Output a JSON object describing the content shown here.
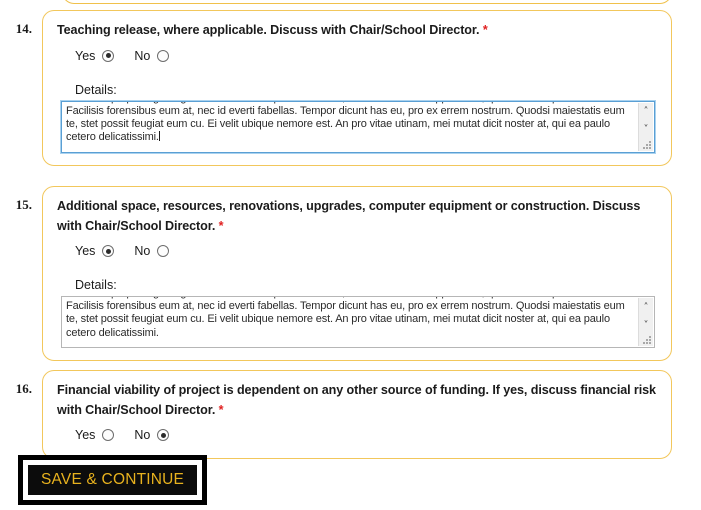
{
  "form": {
    "questions": [
      {
        "number": "14.",
        "text": "Teaching release, where applicable. Discuss with Chair/School Director.",
        "required_marker": "*",
        "radio_group": {
          "options": [
            {
              "label": "Yes",
              "selected": true
            },
            {
              "label": "No",
              "selected": false
            }
          ]
        },
        "details": {
          "label": "Details:",
          "value": "ius nobis propriae gubergren cu. Graeco vulputate ne nam, ius ex elaboraret appellantur, quo cibo erat prima an. Facilisis forensibus eum at, nec id everti fabellas. Tempor dicunt has eu, pro ex errem nostrum. Quodsi maiestatis eum te, stet possit feugiat eum cu. Ei velit ubique nemore est. An pro vitae utinam, mei mutat dicit noster at, qui ea paulo cetero delicatissimi.",
          "focused": true,
          "has_caret": true
        }
      },
      {
        "number": "15.",
        "text": "Additional space, resources, renovations, upgrades, computer equipment or construction. Discuss with Chair/School Director.",
        "required_marker": "*",
        "radio_group": {
          "options": [
            {
              "label": "Yes",
              "selected": true
            },
            {
              "label": "No",
              "selected": false
            }
          ]
        },
        "details": {
          "label": "Details:",
          "value": "ius nobis propriae gubergren cu. Graeco vulputate ne nam, ius ex elaboraret appellantur, quo cibo erat prima an. Facilisis forensibus eum at, nec id everti fabellas. Tempor dicunt has eu, pro ex errem nostrum. Quodsi maiestatis eum te, stet possit feugiat eum cu. Ei velit ubique nemore est. An pro vitae utinam, mei mutat dicit noster at, qui ea paulo cetero delicatissimi.",
          "focused": false,
          "has_caret": false
        }
      },
      {
        "number": "16.",
        "text": "Financial viability of project is dependent on any other source of funding. If yes, discuss financial risk with Chair/School Director.",
        "required_marker": "*",
        "radio_group": {
          "options": [
            {
              "label": "Yes",
              "selected": false
            },
            {
              "label": "No",
              "selected": true
            }
          ]
        },
        "details": null
      }
    ],
    "save_button_label": "SAVE & CONTINUE"
  },
  "colors": {
    "card_border": "#f2c75c",
    "required_asterisk": "#e02020",
    "button_background": "#0c0c0c",
    "button_text": "#e8b21e",
    "focus_border": "#5a9fd4",
    "text": "#1b1b1b"
  },
  "icons": {
    "scroll_up": "˄",
    "scroll_down": "˅"
  }
}
